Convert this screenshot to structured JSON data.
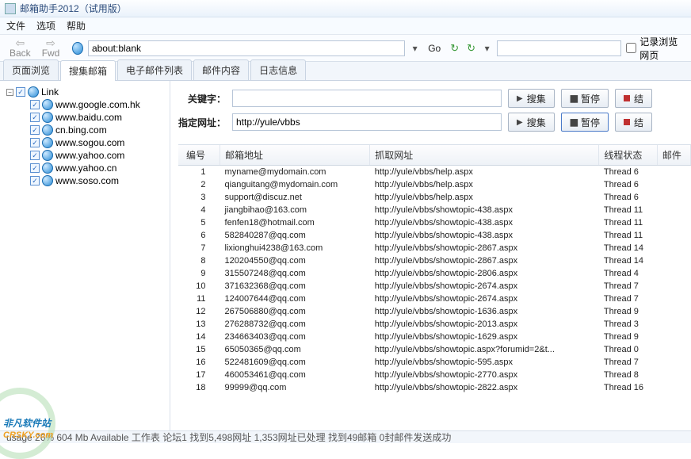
{
  "title": "邮箱助手2012（试用版）",
  "menu": {
    "file": "文件",
    "options": "选项",
    "help": "帮助"
  },
  "nav": {
    "back": "Back",
    "fwd": "Fwd",
    "url": "about:blank",
    "go": "Go",
    "record": "记录浏览网页"
  },
  "tabs": {
    "t0": "页面浏览",
    "t1": "搜集邮箱",
    "t2": "电子邮件列表",
    "t3": "邮件内容",
    "t4": "日志信息"
  },
  "tree": {
    "root": "Link",
    "items": [
      "www.google.com.hk",
      "www.baidu.com",
      "cn.bing.com",
      "www.sogou.com",
      "www.yahoo.com",
      "www.yahoo.cn",
      "www.soso.com"
    ]
  },
  "search": {
    "keyword_label": "关键字：",
    "url_label": "指定网址：",
    "url_value": "http://yule/vbbs",
    "btn_search": "搜集",
    "btn_pause": "暂停",
    "btn_stop": "结"
  },
  "table": {
    "h_num": "编号",
    "h_email": "邮箱地址",
    "h_url": "抓取网址",
    "h_thread": "线程状态",
    "h_mail": "邮件",
    "rows": [
      {
        "n": "1",
        "e": "myname@mydomain.com",
        "u": "http://yule/vbbs/help.aspx",
        "t": "Thread 6"
      },
      {
        "n": "2",
        "e": "qianguitang@mydomain.com",
        "u": "http://yule/vbbs/help.aspx",
        "t": "Thread 6"
      },
      {
        "n": "3",
        "e": "support@discuz.net",
        "u": "http://yule/vbbs/help.aspx",
        "t": "Thread 6"
      },
      {
        "n": "4",
        "e": "jiangbihao@163.com",
        "u": "http://yule/vbbs/showtopic-438.aspx",
        "t": "Thread 11"
      },
      {
        "n": "5",
        "e": "fenfen18@hotmail.com",
        "u": "http://yule/vbbs/showtopic-438.aspx",
        "t": "Thread 11"
      },
      {
        "n": "6",
        "e": "582840287@qq.com",
        "u": "http://yule/vbbs/showtopic-438.aspx",
        "t": "Thread 11"
      },
      {
        "n": "7",
        "e": "lixionghui4238@163.com",
        "u": "http://yule/vbbs/showtopic-2867.aspx",
        "t": "Thread 14"
      },
      {
        "n": "8",
        "e": "120204550@qq.com",
        "u": "http://yule/vbbs/showtopic-2867.aspx",
        "t": "Thread 14"
      },
      {
        "n": "9",
        "e": "315507248@qq.com",
        "u": "http://yule/vbbs/showtopic-2806.aspx",
        "t": "Thread 4"
      },
      {
        "n": "10",
        "e": "371632368@qq.com",
        "u": "http://yule/vbbs/showtopic-2674.aspx",
        "t": "Thread 7"
      },
      {
        "n": "11",
        "e": "124007644@qq.com",
        "u": "http://yule/vbbs/showtopic-2674.aspx",
        "t": "Thread 7"
      },
      {
        "n": "12",
        "e": "267506880@qq.com",
        "u": "http://yule/vbbs/showtopic-1636.aspx",
        "t": "Thread 9"
      },
      {
        "n": "13",
        "e": "276288732@qq.com",
        "u": "http://yule/vbbs/showtopic-2013.aspx",
        "t": "Thread 3"
      },
      {
        "n": "14",
        "e": "234663403@qq.com",
        "u": "http://yule/vbbs/showtopic-1629.aspx",
        "t": "Thread 9"
      },
      {
        "n": "15",
        "e": "65050365@qq.com",
        "u": "http://yule/vbbs/showtopic.aspx?forumid=2&t...",
        "t": "Thread 0"
      },
      {
        "n": "16",
        "e": "522481609@qq.com",
        "u": "http://yule/vbbs/showtopic-595.aspx",
        "t": "Thread 7"
      },
      {
        "n": "17",
        "e": "460053461@qq.com",
        "u": "http://yule/vbbs/showtopic-2770.aspx",
        "t": "Thread 8"
      },
      {
        "n": "18",
        "e": "99999@qq.com",
        "u": "http://yule/vbbs/showtopic-2822.aspx",
        "t": "Thread 16"
      }
    ]
  },
  "status": "usage 26%  604 Mb Available  工作表 论坛1  找到5,498网址  1,353网址已处理  找到49邮箱  0封邮件发送成功",
  "watermark": {
    "main": "非凡软件站",
    "sub": "CRSKY.com"
  }
}
